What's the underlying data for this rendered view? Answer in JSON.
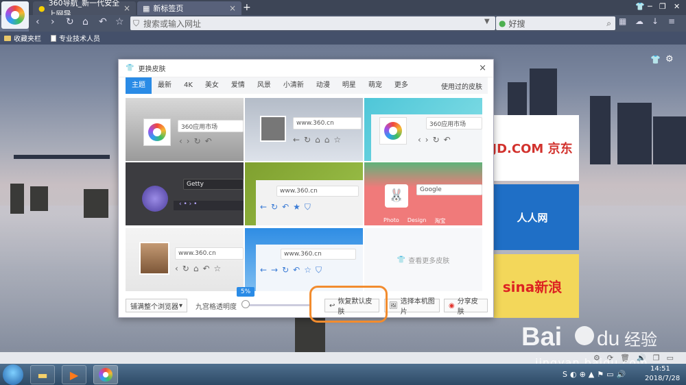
{
  "browser": {
    "tabs": [
      {
        "label": "360导航_新一代安全上网导",
        "close": "×"
      },
      {
        "label": "新标签页",
        "close": "×"
      }
    ],
    "new_tab": "+",
    "address_placeholder": "搜索或输入网址",
    "search_engine": "好搜",
    "bookmarks": [
      "收藏夹栏",
      "专业技术人员"
    ]
  },
  "tiles": {
    "jd": "JD.COM 京东",
    "renren": "人人网",
    "sina": "sina新浪"
  },
  "dialog": {
    "title": "更换皮肤",
    "close": "×",
    "tabs": [
      "主题",
      "最新",
      "4K",
      "美女",
      "爱情",
      "风景",
      "小清新",
      "动漫",
      "明星",
      "萌宠",
      "更多"
    ],
    "used_skins": "使用过的皮肤",
    "thumbs": {
      "t1_bar": "360应用市场",
      "t2_bar": "www.360.cn",
      "t3_bar": "360应用市场",
      "t4_bar": "Getty",
      "t5_bar": "www.360.cn",
      "t6_bar": "Google",
      "t6_links": [
        "Photo",
        "Design",
        "淘宝"
      ],
      "t7_bar": "www.360.cn",
      "t8_bar": "www.360.cn"
    },
    "more_skins": "查看更多皮肤",
    "fullskin": "铺满整个浏览器",
    "opacity_label": "九宫格透明度",
    "opacity_value": "5%",
    "opacity_level": 0.05,
    "btn_restore": "恢复默认皮肤",
    "btn_local": "选择本机图片",
    "btn_share": "分享皮肤"
  },
  "taskbar": {
    "time": "14:51",
    "date": "2018/7/28"
  },
  "watermark": {
    "brand": "Bai du 经验",
    "url": "jingyan.baidu.com"
  },
  "colors": {
    "accent": "#2a8be6",
    "highlight": "#f28c2e"
  }
}
